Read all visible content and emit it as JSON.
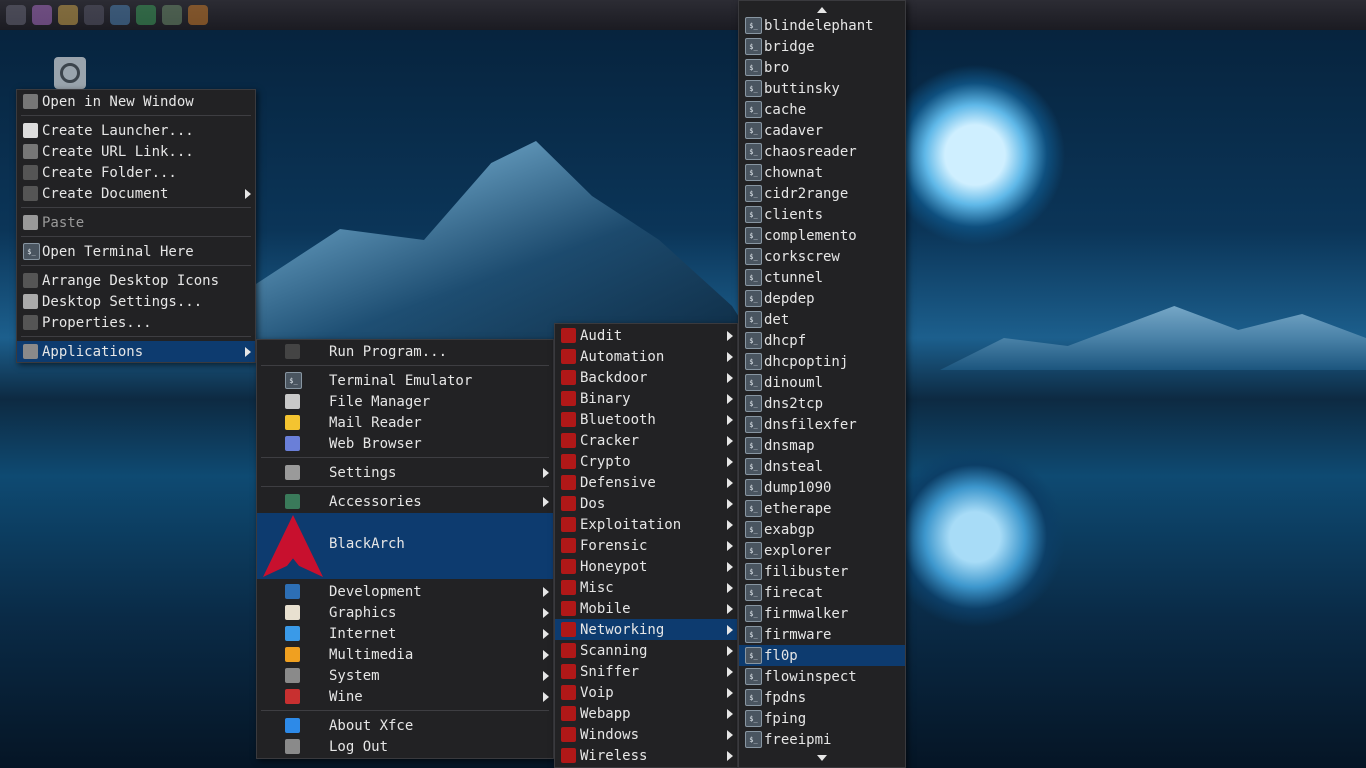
{
  "desktop_menu": {
    "items": [
      {
        "label": "Open in New Window",
        "icon": "folder-open-icon",
        "color": "#777777"
      },
      {
        "label": "Create Launcher...",
        "icon": "launcher-icon",
        "color": "#dddddd"
      },
      {
        "label": "Create URL Link...",
        "icon": "link-icon",
        "color": "#777777"
      },
      {
        "label": "Create Folder...",
        "icon": "folder-icon",
        "color": "#555555"
      },
      {
        "label": "Create Document",
        "icon": "document-icon",
        "color": "#555555",
        "submenu": true
      },
      {
        "label": "Paste",
        "icon": "paste-icon",
        "color": "#999999",
        "disabled": true
      },
      {
        "label": "Open Terminal Here",
        "icon": "terminal-icon",
        "color": "#4a5560"
      },
      {
        "label": "Arrange Desktop Icons",
        "icon": "arrange-icon",
        "color": "#555555"
      },
      {
        "label": "Desktop Settings...",
        "icon": "settings-icon",
        "color": "#aaaaaa"
      },
      {
        "label": "Properties...",
        "icon": "properties-icon",
        "color": "#555555"
      },
      {
        "label": "Applications",
        "icon": "applications-icon",
        "color": "#8a8a8a",
        "submenu": true,
        "selected": true
      }
    ]
  },
  "apps_menu": {
    "items": [
      {
        "label": "Run Program...",
        "icon": "run-program-icon",
        "color": "#444444"
      },
      {
        "label": "Terminal Emulator",
        "icon": "terminal-icon",
        "color": "#4a5560"
      },
      {
        "label": "File Manager",
        "icon": "file-manager-icon",
        "color": "#c9c9c9"
      },
      {
        "label": "Mail Reader",
        "icon": "mail-icon",
        "color": "#f4c430"
      },
      {
        "label": "Web Browser",
        "icon": "web-browser-icon",
        "color": "#6a7fd8"
      },
      {
        "label": "Settings",
        "icon": "settings-icon",
        "color": "#9a9a9a",
        "submenu": true
      },
      {
        "label": "Accessories",
        "icon": "accessories-icon",
        "color": "#3a7a5a",
        "submenu": true
      },
      {
        "label": "BlackArch",
        "icon": "blackarch-logo-icon",
        "color": "#c8102e",
        "submenu": true,
        "selected": true
      },
      {
        "label": "Development",
        "icon": "development-icon",
        "color": "#2d6fb5",
        "submenu": true
      },
      {
        "label": "Graphics",
        "icon": "graphics-icon",
        "color": "#e8e0d0",
        "submenu": true
      },
      {
        "label": "Internet",
        "icon": "internet-icon",
        "color": "#3a9ae8",
        "submenu": true
      },
      {
        "label": "Multimedia",
        "icon": "multimedia-icon",
        "color": "#f0a020",
        "submenu": true
      },
      {
        "label": "System",
        "icon": "system-icon",
        "color": "#8a8a8a",
        "submenu": true
      },
      {
        "label": "Wine",
        "icon": "wine-icon",
        "color": "#c83030",
        "submenu": true
      },
      {
        "label": "About Xfce",
        "icon": "help-icon",
        "color": "#2d8ae8"
      },
      {
        "label": "Log Out",
        "icon": "logout-icon",
        "color": "#8a8a8a"
      }
    ]
  },
  "blackarch_menu": {
    "items": [
      "Audit",
      "Automation",
      "Backdoor",
      "Binary",
      "Bluetooth",
      "Cracker",
      "Crypto",
      "Defensive",
      "Dos",
      "Exploitation",
      "Forensic",
      "Honeypot",
      "Misc",
      "Mobile",
      "Networking",
      "Scanning",
      "Sniffer",
      "Voip",
      "Webapp",
      "Windows",
      "Wireless"
    ],
    "selected": "Networking",
    "icon_color": "#b01818"
  },
  "networking_menu": {
    "items": [
      "blindelephant",
      "bridge",
      "bro",
      "buttinsky",
      "cache",
      "cadaver",
      "chaosreader",
      "chownat",
      "cidr2range",
      "clients",
      "complemento",
      "corkscrew",
      "ctunnel",
      "depdep",
      "det",
      "dhcpf",
      "dhcpoptinj",
      "dinouml",
      "dns2tcp",
      "dnsfilexfer",
      "dnsmap",
      "dnsteal",
      "dump1090",
      "etherape",
      "exabgp",
      "explorer",
      "filibuster",
      "firecat",
      "firmwalker",
      "firmware",
      "fl0p",
      "flowinspect",
      "fpdns",
      "fping",
      "freeipmi"
    ],
    "selected": "fl0p",
    "icon": "terminal-icon"
  },
  "colors": {
    "menu_bg": "#222224",
    "selection": "#0d3b6f",
    "text": "#e6e6e6"
  }
}
